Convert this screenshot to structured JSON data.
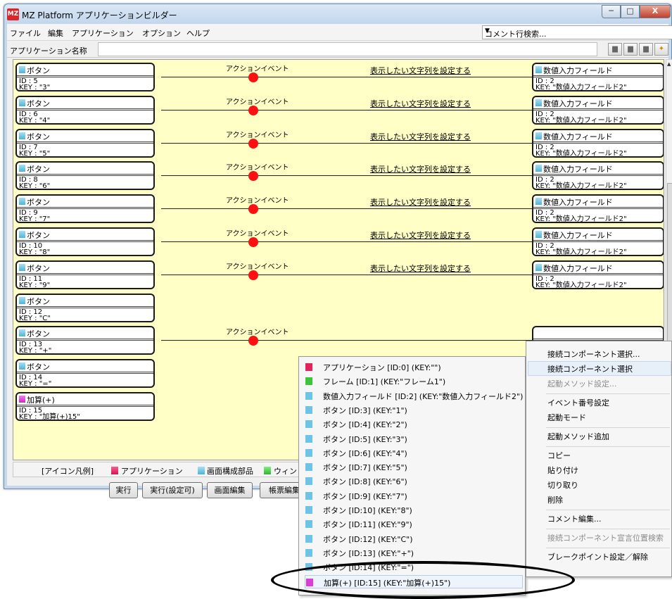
{
  "window": {
    "title": "MZ Platform アプリケーションビルダー",
    "logo": "MZ",
    "controls": {
      "minimize": "─",
      "maximize": "□",
      "close": "X"
    }
  },
  "menu": [
    "ファイル",
    "編集",
    "アプリケーション",
    "オプション",
    "ヘルプ"
  ],
  "comment_search": {
    "value": "コメント行検索...",
    "arrow": "▼"
  },
  "appname": {
    "label": "アプリケーション名称",
    "value": ""
  },
  "toolbar_icons": [
    "folder-icon",
    "folder-icon",
    "folder-icon",
    "new-folder-icon"
  ],
  "canvas": {
    "rows": [
      {
        "name": "ボタン",
        "id": "ID : 5",
        "key": "KEY : \"3\"",
        "event": "アクションイベント",
        "method": "表示したい文字列を設定する",
        "target": {
          "name": "数値入力フィールド",
          "id": "ID : 2",
          "key": "KEY: \"数値入力フィールド2\""
        }
      },
      {
        "name": "ボタン",
        "id": "ID : 6",
        "key": "KEY : \"4\"",
        "event": "アクションイベント",
        "method": "表示したい文字列を設定する",
        "target": {
          "name": "数値入力フィールド",
          "id": "ID : 2",
          "key": "KEY: \"数値入力フィールド2\""
        }
      },
      {
        "name": "ボタン",
        "id": "ID : 7",
        "key": "KEY : \"5\"",
        "event": "アクションイベント",
        "method": "表示したい文字列を設定する",
        "target": {
          "name": "数値入力フィールド",
          "id": "ID : 2",
          "key": "KEY: \"数値入力フィールド2\""
        }
      },
      {
        "name": "ボタン",
        "id": "ID : 8",
        "key": "KEY : \"6\"",
        "event": "アクションイベント",
        "method": "表示したい文字列を設定する",
        "target": {
          "name": "数値入力フィールド",
          "id": "ID : 2",
          "key": "KEY: \"数値入力フィールド2\""
        }
      },
      {
        "name": "ボタン",
        "id": "ID : 9",
        "key": "KEY : \"7\"",
        "event": "アクションイベント",
        "method": "表示したい文字列を設定する",
        "target": {
          "name": "数値入力フィールド",
          "id": "ID : 2",
          "key": "KEY: \"数値入力フィールド2\""
        }
      },
      {
        "name": "ボタン",
        "id": "ID : 10",
        "key": "KEY : \"8\"",
        "event": "アクションイベント",
        "method": "表示したい文字列を設定する",
        "target": {
          "name": "数値入力フィールド",
          "id": "ID : 2",
          "key": "KEY: \"数値入力フィールド2\""
        }
      },
      {
        "name": "ボタン",
        "id": "ID : 11",
        "key": "KEY : \"9\"",
        "event": "アクションイベント",
        "method": "表示したい文字列を設定する",
        "target": {
          "name": "数値入力フィールド",
          "id": "ID : 2",
          "key": "KEY: \"数値入力フィールド2\""
        }
      },
      {
        "name": "ボタン",
        "id": "ID : 12",
        "key": "KEY : \"C\""
      },
      {
        "name": "ボタン",
        "id": "ID : 13",
        "key": "KEY : \"+\"",
        "event": "アクションイベント"
      },
      {
        "name": "ボタン",
        "id": "ID : 14",
        "key": "KEY : \"=\""
      },
      {
        "name": "加算(+)",
        "id": "ID : 15",
        "key": "KEY : \"加算(+)15\""
      }
    ]
  },
  "legend": {
    "title": "[アイコン凡例]",
    "items": [
      "アプリケーション",
      "画面構成部品",
      "ウィン"
    ]
  },
  "buttons": [
    "実行",
    "実行(設定可)",
    "画面編集",
    "帳票編集"
  ],
  "component_list": [
    {
      "label": "アプリケーション [ID:0] (KEY:\"\")",
      "color": "#e0245e"
    },
    {
      "label": "フレーム [ID:1] (KEY:\"フレーム1\")",
      "color": "#3cc43c"
    },
    {
      "label": "数値入力フィールド [ID:2] (KEY:\"数値入力フィールド2\")",
      "color": "#6cc4e6"
    },
    {
      "label": "ボタン [ID:3] (KEY:\"1\")",
      "color": "#6cc4e6"
    },
    {
      "label": "ボタン [ID:4] (KEY:\"2\")",
      "color": "#6cc4e6"
    },
    {
      "label": "ボタン [ID:5] (KEY:\"3\")",
      "color": "#6cc4e6"
    },
    {
      "label": "ボタン [ID:6] (KEY:\"4\")",
      "color": "#6cc4e6"
    },
    {
      "label": "ボタン [ID:7] (KEY:\"5\")",
      "color": "#6cc4e6"
    },
    {
      "label": "ボタン [ID:8] (KEY:\"6\")",
      "color": "#6cc4e6"
    },
    {
      "label": "ボタン [ID:9] (KEY:\"7\")",
      "color": "#6cc4e6"
    },
    {
      "label": "ボタン [ID:10] (KEY:\"8\")",
      "color": "#6cc4e6"
    },
    {
      "label": "ボタン [ID:11] (KEY:\"9\")",
      "color": "#6cc4e6"
    },
    {
      "label": "ボタン [ID:12] (KEY:\"C\")",
      "color": "#6cc4e6"
    },
    {
      "label": "ボタン [ID:13] (KEY:\"+\")",
      "color": "#6cc4e6"
    },
    {
      "label": "ボタン [ID:14] (KEY:\"=\")",
      "color": "#6cc4e6"
    },
    {
      "label": "加算(+) [ID:15] (KEY:\"加算(+)15\")",
      "color": "#dc3cd8"
    }
  ],
  "context_menu": [
    {
      "label": "接続コンポーネント選択...",
      "enabled": true
    },
    {
      "label": "接続コンポーネント選択",
      "enabled": true,
      "highlighted": true
    },
    {
      "label": "起動メソッド設定...",
      "enabled": false
    },
    {
      "separator": true
    },
    {
      "label": "イベント番号設定",
      "enabled": true
    },
    {
      "label": "起動モード",
      "enabled": true
    },
    {
      "separator": true
    },
    {
      "label": "起動メソッド追加",
      "enabled": true
    },
    {
      "separator": true
    },
    {
      "label": "コピー",
      "enabled": true
    },
    {
      "label": "貼り付け",
      "enabled": true
    },
    {
      "label": "切り取り",
      "enabled": true
    },
    {
      "label": "削除",
      "enabled": true
    },
    {
      "separator": true
    },
    {
      "label": "コメント編集...",
      "enabled": true
    },
    {
      "separator": true
    },
    {
      "label": "接続コンポーネント宣言位置検索",
      "enabled": false
    },
    {
      "separator": true
    },
    {
      "label": "ブレークポイント設定／解除",
      "enabled": true
    }
  ],
  "colors": {
    "canvas_bg": "#ffffc6",
    "connector_dot": "#ff1111",
    "app_icon": "#e0245e",
    "frame_icon": "#3cc43c",
    "part_icon": "#6cc4e6",
    "func_icon": "#dc3cd8"
  }
}
